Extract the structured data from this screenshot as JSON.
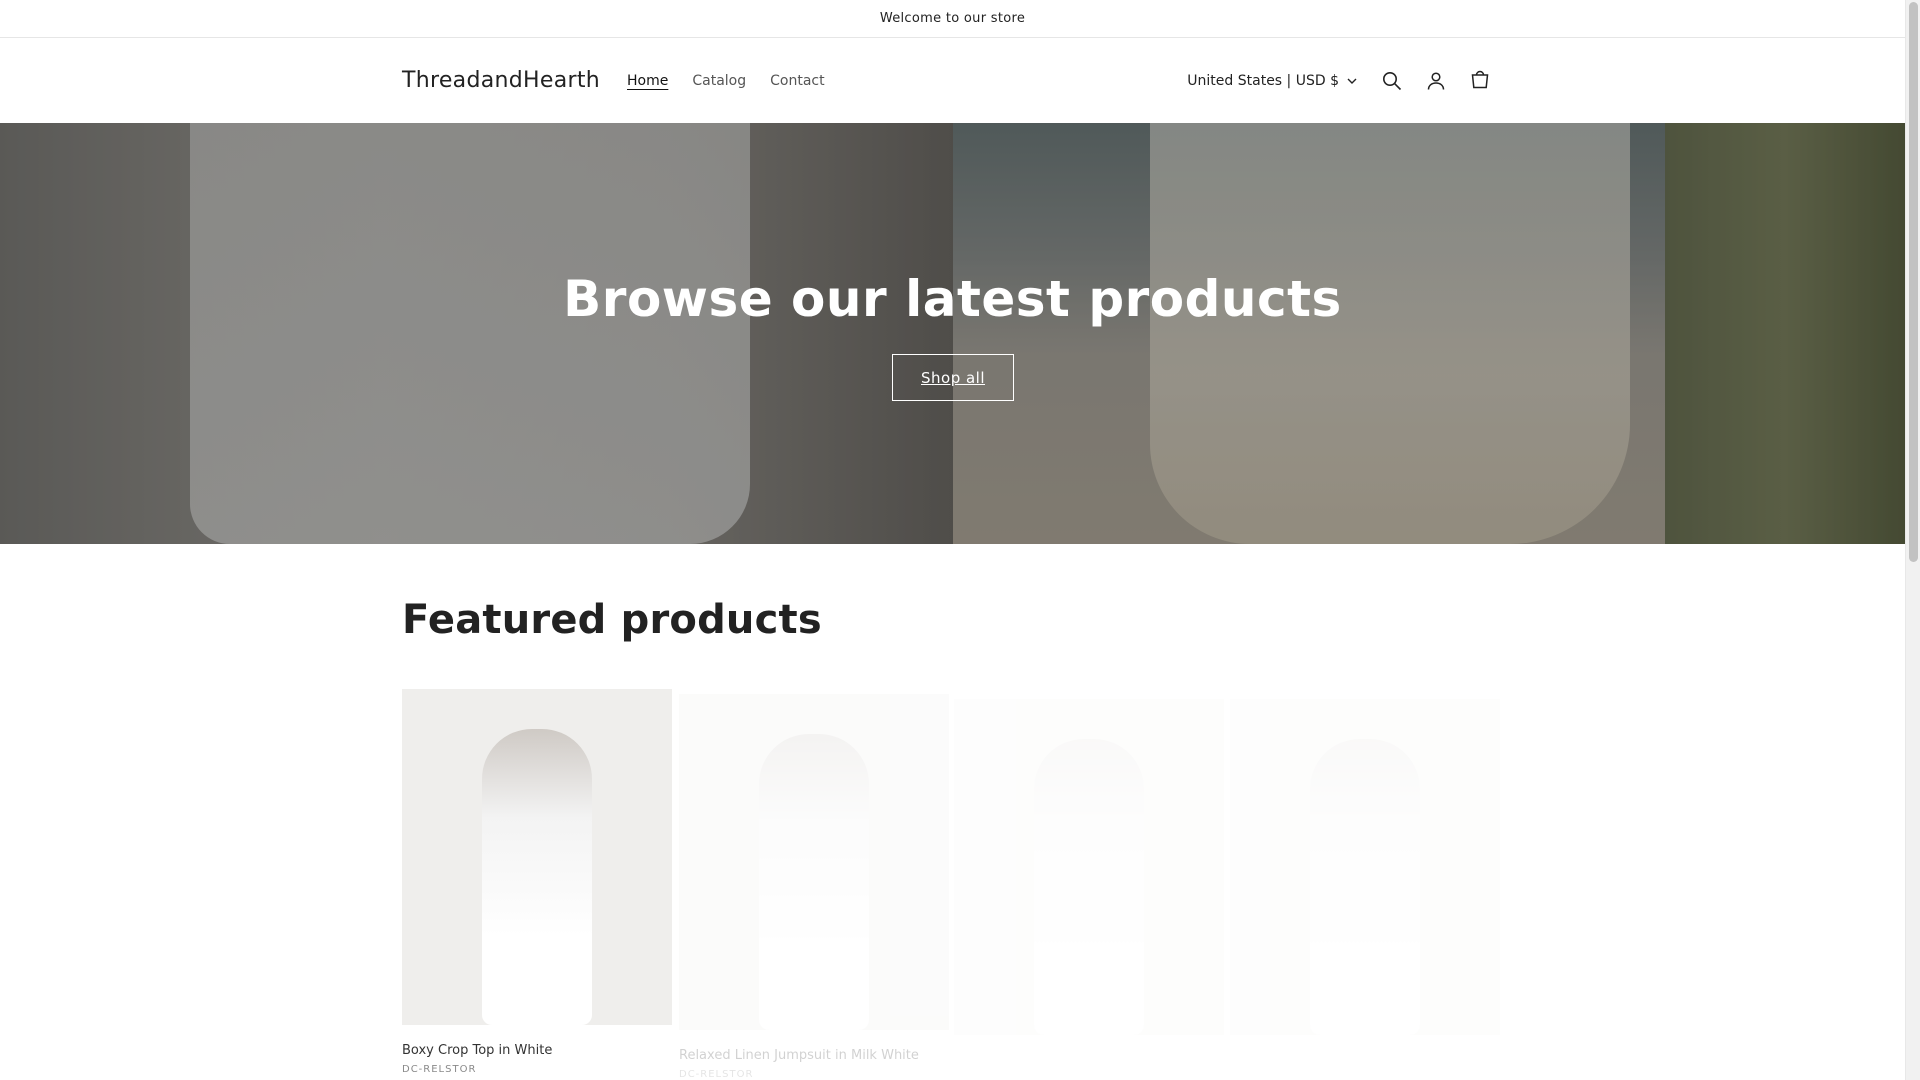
{
  "announcement": "Welcome to our store",
  "header": {
    "brand": "ThreadandHearth",
    "nav": [
      {
        "label": "Home",
        "active": true
      },
      {
        "label": "Catalog",
        "active": false
      },
      {
        "label": "Contact",
        "active": false
      }
    ],
    "locale": "United States | USD $",
    "icons": [
      "search-icon",
      "account-icon",
      "cart-icon"
    ]
  },
  "hero": {
    "title": "Browse our latest products",
    "button": "Shop all"
  },
  "featured": {
    "title": "Featured products",
    "products": [
      {
        "name": "Boxy Crop Top in White",
        "vendor": "DC-RELSTOR"
      },
      {
        "name": "Relaxed Linen Jumpsuit in Milk White",
        "vendor": "DC-RELSTOR"
      }
    ]
  },
  "colors": {
    "text": "#121212",
    "background": "#ffffff",
    "overlay": "rgba(0,0,0,0.28)"
  }
}
